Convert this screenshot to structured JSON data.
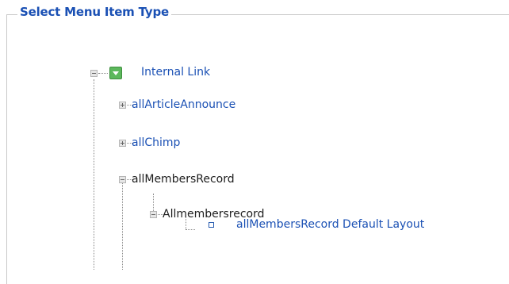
{
  "panel": {
    "title": "Select Menu Item Type"
  },
  "tree": {
    "root": {
      "label": "Internal Link",
      "expanded": true
    },
    "children": [
      {
        "label": "allArticleAnnounce",
        "expanded": false
      },
      {
        "label": "allChimp",
        "expanded": false
      },
      {
        "label": "allMembersRecord",
        "expanded": true,
        "view": {
          "label": "Allmembersrecord",
          "expanded": true,
          "layout": {
            "label": "allMembersRecord Default Layout"
          }
        }
      }
    ]
  },
  "colors": {
    "link": "#1a50b4",
    "title": "#1a50b4",
    "text": "#1e1e1e",
    "icon_green": "#5cb85c",
    "border": "#c9c9c9"
  }
}
